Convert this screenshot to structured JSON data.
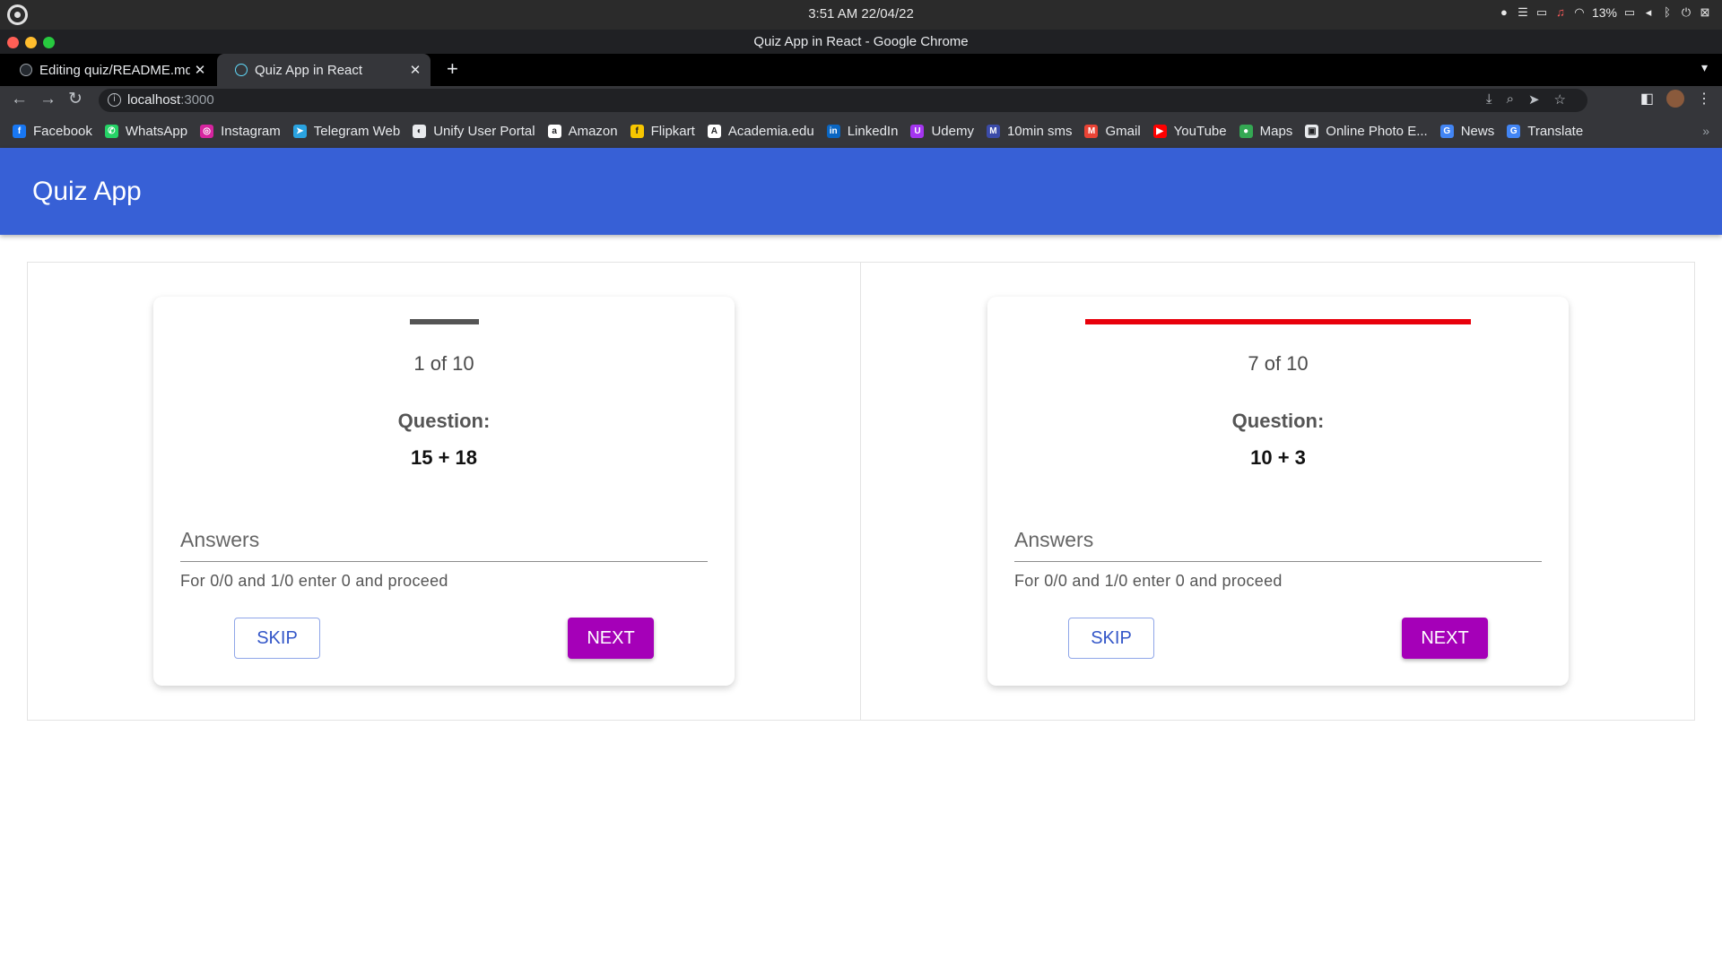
{
  "os": {
    "clock": "3:51 AM  22/04/22",
    "battery": "13%"
  },
  "window": {
    "title": "Quiz App in React - Google Chrome"
  },
  "tabs": [
    {
      "label": "Editing quiz/README.md",
      "icon": "github-icon",
      "active": false
    },
    {
      "label": "Quiz App in React",
      "icon": "react-icon",
      "active": true
    }
  ],
  "address": {
    "host": "localhost",
    "port": ":3000"
  },
  "bookmarks": [
    {
      "label": "Facebook",
      "icon": "facebook-icon",
      "color": "#1877f2",
      "glyph": "f"
    },
    {
      "label": "WhatsApp",
      "icon": "whatsapp-icon",
      "color": "#25d366",
      "glyph": "✆"
    },
    {
      "label": "Instagram",
      "icon": "instagram-icon",
      "color": "#d6249f",
      "glyph": "◎"
    },
    {
      "label": "Telegram Web",
      "icon": "telegram-icon",
      "color": "#2aa3e0",
      "glyph": "➤"
    },
    {
      "label": "Unify User Portal",
      "icon": "unify-icon",
      "color": "#e8eaed",
      "glyph": "◐"
    },
    {
      "label": "Amazon",
      "icon": "amazon-icon",
      "color": "#ffffff",
      "glyph": "a"
    },
    {
      "label": "Flipkart",
      "icon": "flipkart-icon",
      "color": "#f7c600",
      "glyph": "f"
    },
    {
      "label": "Academia.edu",
      "icon": "academia-icon",
      "color": "#ffffff",
      "glyph": "A"
    },
    {
      "label": "LinkedIn",
      "icon": "linkedin-icon",
      "color": "#0a66c2",
      "glyph": "in"
    },
    {
      "label": "Udemy",
      "icon": "udemy-icon",
      "color": "#a435f0",
      "glyph": "U"
    },
    {
      "label": "10min sms",
      "icon": "sms-icon",
      "color": "#3b4ba8",
      "glyph": "M"
    },
    {
      "label": "Gmail",
      "icon": "gmail-icon",
      "color": "#ea4335",
      "glyph": "M"
    },
    {
      "label": "YouTube",
      "icon": "youtube-icon",
      "color": "#ff0000",
      "glyph": "▶"
    },
    {
      "label": "Maps",
      "icon": "maps-icon",
      "color": "#34a853",
      "glyph": "●"
    },
    {
      "label": "Online Photo E...",
      "icon": "photo-icon",
      "color": "#e8eaed",
      "glyph": "▣"
    },
    {
      "label": "News",
      "icon": "news-icon",
      "color": "#4285f4",
      "glyph": "G"
    },
    {
      "label": "Translate",
      "icon": "translate-icon",
      "color": "#4285f4",
      "glyph": "G"
    }
  ],
  "app": {
    "title": "Quiz App",
    "header_color": "#3760d6"
  },
  "quizzes": [
    {
      "counter": "1 of 10",
      "progress": 0.1,
      "progress_color": "#555555",
      "question_label": "Question:",
      "question": "15 + 18",
      "answer_placeholder": "Answers",
      "hint": "For 0/0 and 1/0 enter 0 and proceed",
      "skip_label": "SKIP",
      "next_label": "NEXT"
    },
    {
      "counter": "7 of 10",
      "progress": 0.7,
      "progress_color": "#e8000b",
      "question_label": "Question:",
      "question": "10 + 3",
      "answer_placeholder": "Answers",
      "hint": "For 0/0 and 1/0 enter 0 and proceed",
      "skip_label": "SKIP",
      "next_label": "NEXT"
    }
  ],
  "colors": {
    "skip": "#3356c8",
    "next": "#a500b8"
  }
}
